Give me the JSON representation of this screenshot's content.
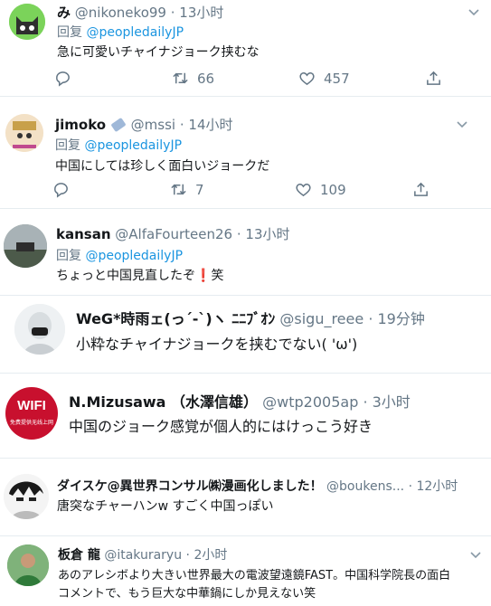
{
  "tweets": [
    {
      "name": "み",
      "handle": "@nikoneko99",
      "time": "· 13小时",
      "reply_prefix": "回复",
      "reply_to": "@peopledailyJP",
      "text": "急に可愛いチャイナジョーク挟むな",
      "retweets": "66",
      "likes": "457"
    },
    {
      "name": "jimoko",
      "handle": "@mssi",
      "time": "· 14小时",
      "reply_prefix": "回复",
      "reply_to": "@peopledailyJP",
      "text": "中国にしては珍しく面白いジョークだ",
      "retweets": "7",
      "likes": "109"
    },
    {
      "name": "kansan",
      "handle": "@AlfaFourteen26",
      "time": "· 13小时",
      "reply_prefix": "回复",
      "reply_to": "@peopledailyJP",
      "text": "ちょっと中国見直したぞ",
      "text_mark": "❗",
      "text_tail": "笑"
    },
    {
      "name": "WeG*時雨ェ(っ´-`)ヽ ﾆﾆﾌﾞｵﾝ",
      "handle": "@sigu_reee",
      "time": "· 19分钟",
      "text": "小粋なチャイナジョークを挟むでない( 'ω')"
    },
    {
      "name": "N.Mizusawa （水澤信雄）",
      "handle": "@wtp2005ap",
      "time": "· 3小时",
      "text": "中国のジョーク感覚が個人的にはけっこう好き",
      "avatar_text": "WIFI",
      "avatar_sub": "免费提供无线上网"
    },
    {
      "name": "ダイスケ@異世界コンサル㈱漫画化しました！",
      "handle": "@boukens...",
      "time": "· 12小时",
      "text": "唐突なチャーハンw すごく中国っぽい"
    },
    {
      "name": "板倉 龍",
      "handle": "@itakuraryu",
      "time": "· 2小时",
      "text_line1": "あのアレシボより大きい世界最大の電波望遠鏡FAST。中国科学院長の面白",
      "text_line2": "コメントで、もう巨大な中華鍋にしか見えない笑"
    }
  ],
  "icons": [
    "chevron-down-icon",
    "reply-icon",
    "retweet-icon",
    "like-icon",
    "share-icon"
  ],
  "colors": {
    "link": "#1b95e0",
    "muted": "#657786",
    "separator": "#e6ecf0"
  }
}
